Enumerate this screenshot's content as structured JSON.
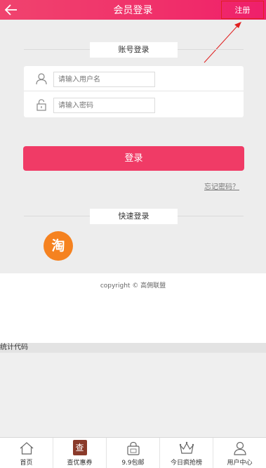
{
  "header": {
    "title": "会员登录",
    "register_label": "注册"
  },
  "account_login": {
    "section_label": "账号登录",
    "username_placeholder": "请输入用户名",
    "password_placeholder": "请输入密码",
    "login_label": "登录",
    "forgot_label": "忘记密码？"
  },
  "quick_login": {
    "section_label": "快速登录",
    "taobao_glyph": "淘",
    "taobao_color": "#f58220"
  },
  "footer": {
    "copyright": "copyright © 高佣联盟",
    "stats_label": "统计代码"
  },
  "tabbar": {
    "items": [
      {
        "label": "首页",
        "icon": "home-icon"
      },
      {
        "label": "查优惠券",
        "icon": "coupon-search-icon",
        "glyph": "查"
      },
      {
        "label": "9.9包邮",
        "icon": "bag-icon"
      },
      {
        "label": "今日疯抢榜",
        "icon": "crown-icon"
      },
      {
        "label": "用户中心",
        "icon": "user-icon"
      }
    ]
  },
  "colors": {
    "brand": "#f03b66",
    "accent_outline": "#e02020"
  }
}
